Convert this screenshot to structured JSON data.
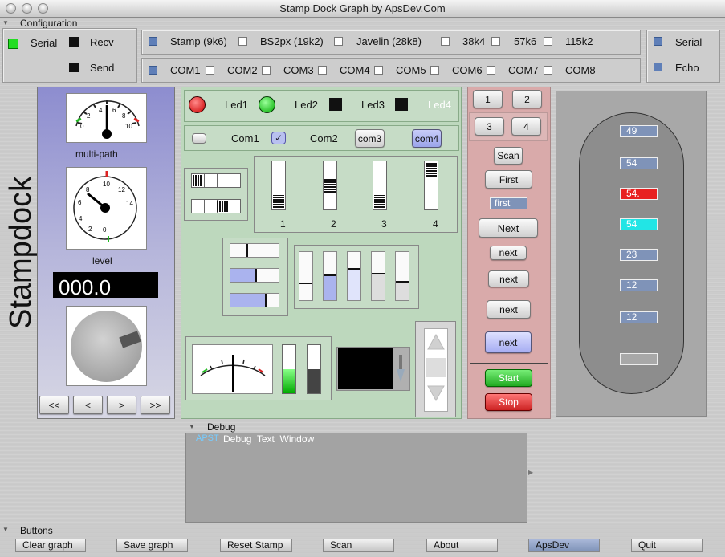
{
  "window": {
    "title": "Stamp Dock Graph by ApsDev.Com"
  },
  "config": {
    "section_label": "Configuration",
    "serial_label": "Serial",
    "recv_label": "Recv",
    "send_label": "Send",
    "stamps": [
      "Stamp (9k6)",
      "BS2px (19k2)",
      "Javelin (28k8)",
      "38k4",
      "57k6",
      "115k2"
    ],
    "coms": [
      "COM1",
      "COM2",
      "COM3",
      "COM4",
      "COM5",
      "COM6",
      "COM7",
      "COM8"
    ],
    "right_serial": "Serial",
    "right_echo": "Echo"
  },
  "side_title": "Stampdock",
  "gauges": {
    "multipath_label": "multi-path",
    "level_label": "level",
    "display_value": "000.0"
  },
  "nav": [
    "<<",
    "<",
    ">",
    ">>"
  ],
  "leds": [
    "Led1",
    "Led2",
    "Led3",
    "Led4"
  ],
  "coms_row": [
    "Com1",
    "Com2",
    "com3",
    "com4"
  ],
  "slider_labels": [
    "1",
    "2",
    "3",
    "4"
  ],
  "red_panel": {
    "num_buttons": [
      "1",
      "2",
      "3",
      "4"
    ],
    "scan": "Scan",
    "first": "First",
    "first_field": "first",
    "next_big": "Next",
    "next_items": [
      "next",
      "next",
      "next",
      "next"
    ],
    "start": "Start",
    "stop": "Stop"
  },
  "values": [
    "49",
    "54",
    "54.",
    "54",
    "23",
    "12",
    "12",
    ""
  ],
  "value_colors": {
    "highlight_red": "#e82020",
    "highlight_cyan": "#22e5e5",
    "normal": "#7f93b8"
  },
  "debug": {
    "section_label": "Debug",
    "prefix": "APST",
    "text": "Debug  Text  Window"
  },
  "buttons": {
    "section_label": "Buttons",
    "items": [
      "Clear graph",
      "Save graph",
      "Reset Stamp",
      "Scan",
      "About",
      "ApsDev",
      "Quit"
    ]
  }
}
